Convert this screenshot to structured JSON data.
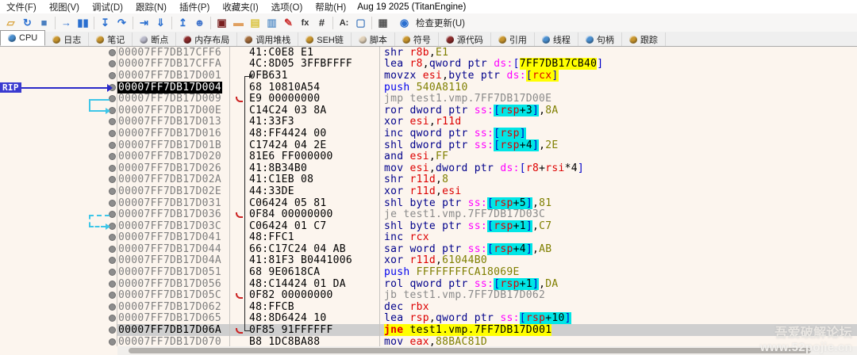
{
  "window": {
    "title_date": "Aug 19 2025 (TitanEngine)"
  },
  "menubar": {
    "items": [
      {
        "id": "file",
        "label": "文件(F)"
      },
      {
        "id": "view",
        "label": "视图(V)"
      },
      {
        "id": "debug",
        "label": "调试(D)"
      },
      {
        "id": "trace",
        "label": "跟踪(N)"
      },
      {
        "id": "plugins",
        "label": "插件(P)"
      },
      {
        "id": "favourites",
        "label": "收藏夹(I)"
      },
      {
        "id": "options",
        "label": "选项(O)"
      },
      {
        "id": "help",
        "label": "帮助(H)"
      }
    ]
  },
  "toolbar": {
    "update_label": "检查更新(U)",
    "icons": [
      {
        "id": "open-file",
        "glyph": "▱",
        "color": "#d9a33c"
      },
      {
        "id": "restart",
        "glyph": "↻",
        "color": "#2a6fd0"
      },
      {
        "id": "close",
        "glyph": "■",
        "color": "#4a7fc0"
      },
      {
        "sep": true
      },
      {
        "id": "run",
        "glyph": "→",
        "color": "#2a6fd0"
      },
      {
        "id": "pause",
        "glyph": "▮▮",
        "color": "#2a6fd0"
      },
      {
        "sep": true
      },
      {
        "id": "step-into",
        "glyph": "↧",
        "color": "#2a6fd0"
      },
      {
        "id": "step-over",
        "glyph": "↷",
        "color": "#2a6fd0"
      },
      {
        "sep": true
      },
      {
        "id": "run-to-cursor",
        "glyph": "⇥",
        "color": "#2a6fd0"
      },
      {
        "id": "execute-till-return",
        "glyph": "⇓",
        "color": "#2a6fd0"
      },
      {
        "sep": true
      },
      {
        "id": "run-to-user-code",
        "glyph": "↥",
        "color": "#2a6fd0"
      },
      {
        "id": "step-user",
        "glyph": "☻",
        "color": "#4477cc"
      },
      {
        "sep": true
      },
      {
        "id": "breakpoints",
        "glyph": "▣",
        "color": "#7a2020"
      },
      {
        "id": "patch",
        "glyph": "▬",
        "color": "#e0a060"
      },
      {
        "id": "comment",
        "glyph": "▤",
        "color": "#d9c23c"
      },
      {
        "id": "label",
        "glyph": "▥",
        "color": "#6699cc"
      },
      {
        "id": "edit",
        "glyph": "✎",
        "color": "#cc3333"
      },
      {
        "id": "fx",
        "glyph": "fx",
        "color": "#333333"
      },
      {
        "id": "hash",
        "glyph": "#",
        "color": "#333333"
      },
      {
        "sep": true
      },
      {
        "id": "assemble",
        "glyph": "A:",
        "color": "#333333"
      },
      {
        "id": "memory",
        "glyph": "▢",
        "color": "#4a7fc0"
      },
      {
        "sep": true
      },
      {
        "id": "calculator",
        "glyph": "▦",
        "color": "#555555"
      },
      {
        "id": "check-updates-globe",
        "glyph": "◉",
        "color": "#2a6fd0"
      }
    ]
  },
  "tabs": [
    {
      "id": "cpu",
      "label": "CPU",
      "color": "#4a8fd0",
      "active": true
    },
    {
      "id": "log",
      "label": "日志",
      "color": "#c9962e",
      "active": false
    },
    {
      "id": "notes",
      "label": "笔记",
      "color": "#c9962e",
      "active": false
    },
    {
      "id": "breakpoints",
      "label": "断点",
      "color": "#b9b9c9",
      "active": false
    },
    {
      "id": "memory-map",
      "label": "内存布局",
      "color": "#8a2a2a",
      "active": false
    },
    {
      "id": "call-stack",
      "label": "调用堆栈",
      "color": "#a06a3a",
      "active": false
    },
    {
      "id": "seh-chain",
      "label": "SEH链",
      "color": "#c9962e",
      "active": false
    },
    {
      "id": "script",
      "label": "脚本",
      "color": "#e0d0b8",
      "active": false
    },
    {
      "id": "symbols",
      "label": "符号",
      "color": "#c9962e",
      "active": false
    },
    {
      "id": "source",
      "label": "源代码",
      "color": "#8a2a2a",
      "active": false
    },
    {
      "id": "references",
      "label": "引用",
      "color": "#c9962e",
      "active": false
    },
    {
      "id": "threads",
      "label": "线程",
      "color": "#4a8fd0",
      "active": false
    },
    {
      "id": "handles",
      "label": "句柄",
      "color": "#4a8fd0",
      "active": false
    },
    {
      "id": "trace",
      "label": "跟踪",
      "color": "#c9962e",
      "active": false
    }
  ],
  "rip_label": "RIP",
  "watermark": {
    "line1": "吾爱破解论坛",
    "line2": "www.52pojie.cn"
  },
  "disasm_rows": [
    {
      "addr": "00007FF7DB17CFF6",
      "bytes": "41:C0E8 E1",
      "dis": [
        [
          "shr ",
          "mn"
        ],
        [
          "r8b",
          "reg"
        ],
        [
          ",",
          "blk"
        ],
        [
          "E1",
          "imm"
        ]
      ]
    },
    {
      "addr": "00007FF7DB17CFFA",
      "bytes": "4C:8D05 3FFBFFFF",
      "dis": [
        [
          "lea ",
          "mn"
        ],
        [
          "r8",
          "reg"
        ],
        [
          ",",
          "blk"
        ],
        [
          "qword ptr ",
          "mn"
        ],
        [
          "ds:",
          "seg"
        ],
        [
          "[",
          "br"
        ],
        [
          "7FF7DB17CB40",
          "blk",
          "y"
        ],
        [
          "]",
          "br"
        ]
      ]
    },
    {
      "addr": "00007FF7DB17D001",
      "bytes": "0FB631",
      "hookTop": true,
      "dis": [
        [
          "movzx ",
          "mn"
        ],
        [
          "esi",
          "reg"
        ],
        [
          ",",
          "blk"
        ],
        [
          "byte ptr ",
          "mn"
        ],
        [
          "ds:",
          "seg"
        ],
        [
          "[",
          "br",
          "y"
        ],
        [
          "rcx",
          "reg",
          "y"
        ],
        [
          "]",
          "br",
          "y"
        ]
      ]
    },
    {
      "addr": "00007FF7DB17D004",
      "bytes": "68 10810A54",
      "sel": true,
      "dis": [
        [
          "push ",
          "pu"
        ],
        [
          "540A8110",
          "imm"
        ]
      ]
    },
    {
      "addr": "00007FF7DB17D009",
      "bytes": "E9 00000000",
      "mark": true,
      "dis": [
        [
          "jmp test1.vmp.7FF7DB17D00E",
          "gr"
        ]
      ]
    },
    {
      "addr": "00007FF7DB17D00E",
      "bytes": "C14C24 03 8A",
      "dis": [
        [
          "ror ",
          "mn"
        ],
        [
          "dword ptr ",
          "mn"
        ],
        [
          "ss:",
          "seg"
        ],
        [
          "[",
          "br",
          "c"
        ],
        [
          "rsp",
          "reg",
          "c"
        ],
        [
          "+3",
          "blk",
          "c"
        ],
        [
          "]",
          "br",
          "c"
        ],
        [
          ",",
          "blk"
        ],
        [
          "8A",
          "imm"
        ]
      ]
    },
    {
      "addr": "00007FF7DB17D013",
      "bytes": "41:33F3",
      "dis": [
        [
          "xor ",
          "mn"
        ],
        [
          "esi",
          "reg"
        ],
        [
          ",",
          "blk"
        ],
        [
          "r11d",
          "reg"
        ]
      ]
    },
    {
      "addr": "00007FF7DB17D016",
      "bytes": "48:FF4424 00",
      "dis": [
        [
          "inc ",
          "mn"
        ],
        [
          "qword ptr ",
          "mn"
        ],
        [
          "ss:",
          "seg"
        ],
        [
          "[",
          "br",
          "c"
        ],
        [
          "rsp",
          "reg",
          "c"
        ],
        [
          "]",
          "br",
          "c"
        ]
      ]
    },
    {
      "addr": "00007FF7DB17D01B",
      "bytes": "C17424 04 2E",
      "dis": [
        [
          "shl ",
          "mn"
        ],
        [
          "dword ptr ",
          "mn"
        ],
        [
          "ss:",
          "seg"
        ],
        [
          "[",
          "br",
          "c"
        ],
        [
          "rsp",
          "reg",
          "c"
        ],
        [
          "+4",
          "blk",
          "c"
        ],
        [
          "]",
          "br",
          "c"
        ],
        [
          ",",
          "blk"
        ],
        [
          "2E",
          "imm"
        ]
      ]
    },
    {
      "addr": "00007FF7DB17D020",
      "bytes": "81E6 FF000000",
      "dis": [
        [
          "and ",
          "mn"
        ],
        [
          "esi",
          "reg"
        ],
        [
          ",",
          "blk"
        ],
        [
          "FF",
          "imm"
        ]
      ]
    },
    {
      "addr": "00007FF7DB17D026",
      "bytes": "41:8B34B0",
      "dis": [
        [
          "mov ",
          "mn"
        ],
        [
          "esi",
          "reg"
        ],
        [
          ",",
          "blk"
        ],
        [
          "dword ptr ",
          "mn"
        ],
        [
          "ds:",
          "seg"
        ],
        [
          "[",
          "br"
        ],
        [
          "r8",
          "reg"
        ],
        [
          "+",
          "blk"
        ],
        [
          "rsi",
          "reg"
        ],
        [
          "*4",
          "blk"
        ],
        [
          "]",
          "br"
        ]
      ]
    },
    {
      "addr": "00007FF7DB17D02A",
      "bytes": "41:C1EB 08",
      "dis": [
        [
          "shr ",
          "mn"
        ],
        [
          "r11d",
          "reg"
        ],
        [
          ",",
          "blk"
        ],
        [
          "8",
          "imm"
        ]
      ]
    },
    {
      "addr": "00007FF7DB17D02E",
      "bytes": "44:33DE",
      "dis": [
        [
          "xor ",
          "mn"
        ],
        [
          "r11d",
          "reg"
        ],
        [
          ",",
          "blk"
        ],
        [
          "esi",
          "reg"
        ]
      ]
    },
    {
      "addr": "00007FF7DB17D031",
      "bytes": "C06424 05 81",
      "dis": [
        [
          "shl ",
          "mn"
        ],
        [
          "byte ptr ",
          "mn"
        ],
        [
          "ss:",
          "seg"
        ],
        [
          "[",
          "br",
          "c"
        ],
        [
          "rsp",
          "reg",
          "c"
        ],
        [
          "+5",
          "blk",
          "c"
        ],
        [
          "]",
          "br",
          "c"
        ],
        [
          ",",
          "blk"
        ],
        [
          "81",
          "imm"
        ]
      ]
    },
    {
      "addr": "00007FF7DB17D036",
      "bytes": "0F84 00000000",
      "mark": true,
      "dis": [
        [
          "je test1.vmp.7FF7DB17D03C",
          "gr"
        ]
      ]
    },
    {
      "addr": "00007FF7DB17D03C",
      "bytes": "C06424 01 C7",
      "dis": [
        [
          "shl ",
          "mn"
        ],
        [
          "byte ptr ",
          "mn"
        ],
        [
          "ss:",
          "seg"
        ],
        [
          "[",
          "br",
          "c"
        ],
        [
          "rsp",
          "reg",
          "c"
        ],
        [
          "+1",
          "blk",
          "c"
        ],
        [
          "]",
          "br",
          "c"
        ],
        [
          ",",
          "blk"
        ],
        [
          "C7",
          "imm"
        ]
      ]
    },
    {
      "addr": "00007FF7DB17D041",
      "bytes": "48:FFC1",
      "dis": [
        [
          "inc ",
          "mn"
        ],
        [
          "rcx",
          "reg"
        ]
      ]
    },
    {
      "addr": "00007FF7DB17D044",
      "bytes": "66:C17C24 04 AB",
      "dis": [
        [
          "sar ",
          "mn"
        ],
        [
          "word ptr ",
          "mn"
        ],
        [
          "ss:",
          "seg"
        ],
        [
          "[",
          "br",
          "c"
        ],
        [
          "rsp",
          "reg",
          "c"
        ],
        [
          "+4",
          "blk",
          "c"
        ],
        [
          "]",
          "br",
          "c"
        ],
        [
          ",",
          "blk"
        ],
        [
          "AB",
          "imm"
        ]
      ]
    },
    {
      "addr": "00007FF7DB17D04A",
      "bytes": "41:81F3 B0441006",
      "dis": [
        [
          "xor ",
          "mn"
        ],
        [
          "r11d",
          "reg"
        ],
        [
          ",",
          "blk"
        ],
        [
          "61044B0",
          "imm"
        ]
      ]
    },
    {
      "addr": "00007FF7DB17D051",
      "bytes": "68 9E0618CA",
      "dis": [
        [
          "push ",
          "pu"
        ],
        [
          "FFFFFFFFCA18069E",
          "imm"
        ]
      ]
    },
    {
      "addr": "00007FF7DB17D056",
      "bytes": "48:C14424 01 DA",
      "dis": [
        [
          "rol ",
          "mn"
        ],
        [
          "qword ptr ",
          "mn"
        ],
        [
          "ss:",
          "seg"
        ],
        [
          "[",
          "br",
          "c"
        ],
        [
          "rsp",
          "reg",
          "c"
        ],
        [
          "+1",
          "blk",
          "c"
        ],
        [
          "]",
          "br",
          "c"
        ],
        [
          ",",
          "blk"
        ],
        [
          "DA",
          "imm"
        ]
      ]
    },
    {
      "addr": "00007FF7DB17D05C",
      "bytes": "0F82 00000000",
      "mark": true,
      "dis": [
        [
          "jb test1.vmp.7FF7DB17D062",
          "gr"
        ]
      ]
    },
    {
      "addr": "00007FF7DB17D062",
      "bytes": "48:FFCB",
      "dis": [
        [
          "dec ",
          "mn"
        ],
        [
          "rbx",
          "reg"
        ]
      ]
    },
    {
      "addr": "00007FF7DB17D065",
      "bytes": "48:8D6424 10",
      "dis": [
        [
          "lea ",
          "mn"
        ],
        [
          "rsp",
          "reg"
        ],
        [
          ",",
          "blk"
        ],
        [
          "qword ptr ",
          "mn"
        ],
        [
          "ss:",
          "seg"
        ],
        [
          "[",
          "br",
          "c"
        ],
        [
          "rsp",
          "reg",
          "c"
        ],
        [
          "+10",
          "blk",
          "c"
        ],
        [
          "]",
          "br",
          "c"
        ]
      ]
    },
    {
      "addr": "00007FF7DB17D06A",
      "bytes": "0F85 91FFFFFF",
      "hl": true,
      "mark": true,
      "hookBottom": true,
      "dis": [
        [
          "jne",
          "jne",
          "y"
        ],
        [
          " ",
          "blk",
          "y"
        ],
        [
          "test1.vmp.7FF7DB17D001",
          "blk",
          "y"
        ]
      ]
    },
    {
      "addr": "00007FF7DB17D070",
      "bytes": "B8 1DC8BA88",
      "dis": [
        [
          "mov ",
          "mn"
        ],
        [
          "eax",
          "reg"
        ],
        [
          ",",
          "blk"
        ],
        [
          "88BAC81D",
          "imm"
        ]
      ]
    }
  ]
}
